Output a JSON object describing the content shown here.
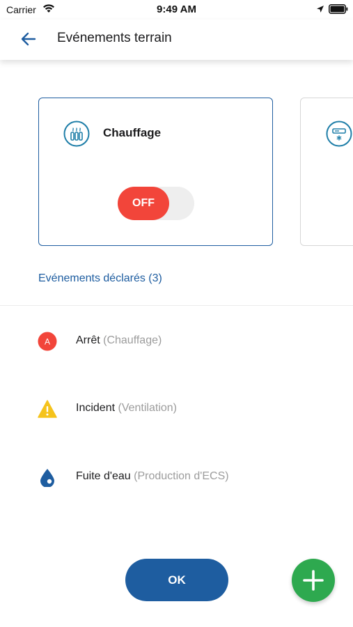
{
  "status_bar": {
    "carrier": "Carrier",
    "time": "9:49 AM"
  },
  "nav": {
    "title": "Evénements terrain"
  },
  "cards": [
    {
      "title": "Chauffage",
      "icon": "radiator-icon",
      "toggle_label": "OFF",
      "state": "off"
    },
    {
      "title": "",
      "icon": "ventilation-unit-icon"
    }
  ],
  "events": {
    "header": "Evénements déclarés (3)",
    "items": [
      {
        "label": "Arrêt",
        "category": "(Chauffage)",
        "icon": "stop-badge-icon",
        "badge_letter": "A",
        "color": "#f2453a"
      },
      {
        "label": "Incident",
        "category": "(Ventilation)",
        "icon": "warning-triangle-icon",
        "badge_letter": "!",
        "color": "#f5c31c"
      },
      {
        "label": "Fuite d'eau",
        "category": "(Production d'ECS)",
        "icon": "water-drop-icon",
        "color": "#1e5da0"
      }
    ]
  },
  "actions": {
    "ok_label": "OK",
    "add_icon": "plus-icon"
  },
  "colors": {
    "primary": "#1e5da0",
    "danger": "#f2453a",
    "warning": "#f5c31c",
    "success": "#2ea94f"
  }
}
